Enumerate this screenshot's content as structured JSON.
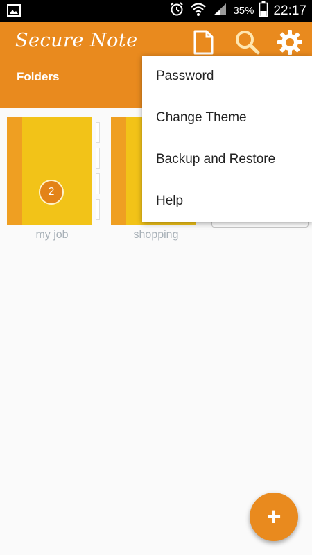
{
  "status_bar": {
    "battery": "35%",
    "time": "22:17",
    "icons": [
      "gallery-icon",
      "alarm-icon",
      "wifi-icon",
      "signal-icon",
      "battery-icon"
    ]
  },
  "app_bar": {
    "title": "Secure Note",
    "section": "Folders",
    "icons": [
      "new-note-icon",
      "search-icon",
      "gear-icon"
    ],
    "background": "#e98a1e"
  },
  "folders": [
    {
      "name": "my job",
      "badge": "2"
    },
    {
      "name": "shopping"
    }
  ],
  "menu": {
    "items": [
      "Password",
      "Change Theme",
      "Backup and Restore",
      "Help"
    ]
  },
  "fab": {
    "label": "+"
  }
}
